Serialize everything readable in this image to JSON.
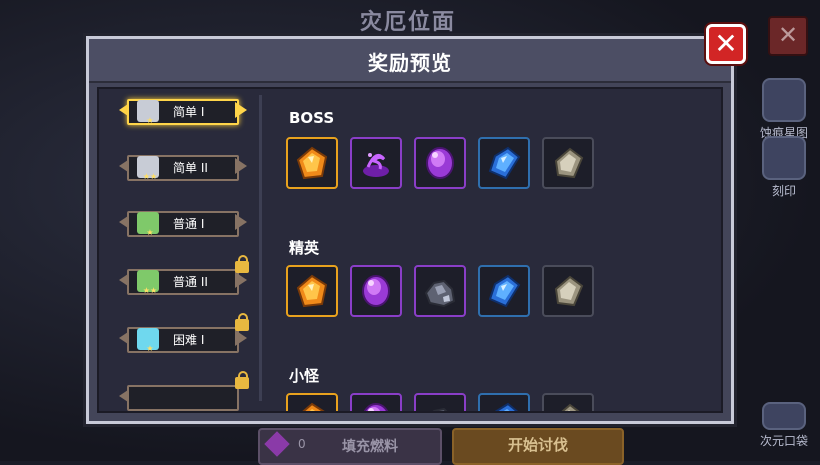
{
  "background": {
    "title": "灾厄位面",
    "close_label": "✕",
    "side_buttons": [
      {
        "label": "蚀痕星图",
        "icon": "star-map-icon"
      },
      {
        "label": "刻印",
        "icon": "engraving-icon"
      },
      {
        "label": "次元口袋",
        "icon": "dimension-pocket-icon"
      }
    ],
    "fuel_count": "0",
    "fuel_label": "填充燃料",
    "start_label": "开始讨伐"
  },
  "modal": {
    "title": "奖励预览",
    "close_label": "✕",
    "difficulties": [
      {
        "label": "简单 I",
        "stars": "★",
        "tone": "#c8ccd6",
        "selected": true,
        "locked": false
      },
      {
        "label": "简单 II",
        "stars": "★★",
        "tone": "#c8ccd6",
        "selected": false,
        "locked": false
      },
      {
        "label": "普通 I",
        "stars": "★",
        "tone": "#7fc96a",
        "selected": false,
        "locked": false
      },
      {
        "label": "普通 II",
        "stars": "★★",
        "tone": "#7fc96a",
        "selected": false,
        "locked": true
      },
      {
        "label": "困难 I",
        "stars": "★",
        "tone": "#6fd8ee",
        "selected": false,
        "locked": true
      }
    ],
    "sections": [
      {
        "title": "BOSS",
        "items": [
          {
            "icon": "orange-crystal-icon",
            "rarity": "orange"
          },
          {
            "icon": "purple-swirl-icon",
            "rarity": "purple"
          },
          {
            "icon": "purple-gem-icon",
            "rarity": "purple"
          },
          {
            "icon": "blue-crystal-icon",
            "rarity": "blue"
          },
          {
            "icon": "grey-stone-icon",
            "rarity": "grey"
          }
        ]
      },
      {
        "title": "精英",
        "items": [
          {
            "icon": "orange-crystal-icon",
            "rarity": "orange"
          },
          {
            "icon": "purple-gem-icon",
            "rarity": "purple"
          },
          {
            "icon": "ore-chunk-icon",
            "rarity": "purple"
          },
          {
            "icon": "blue-crystal-icon",
            "rarity": "blue"
          },
          {
            "icon": "grey-stone-icon",
            "rarity": "grey"
          }
        ]
      },
      {
        "title": "小怪",
        "items": [
          {
            "icon": "orange-crystal-icon",
            "rarity": "orange"
          },
          {
            "icon": "purple-gem-icon",
            "rarity": "purple"
          },
          {
            "icon": "ore-chunk-icon",
            "rarity": "purple"
          },
          {
            "icon": "blue-crystal-icon",
            "rarity": "blue"
          },
          {
            "icon": "grey-stone-icon",
            "rarity": "grey"
          }
        ]
      }
    ]
  }
}
